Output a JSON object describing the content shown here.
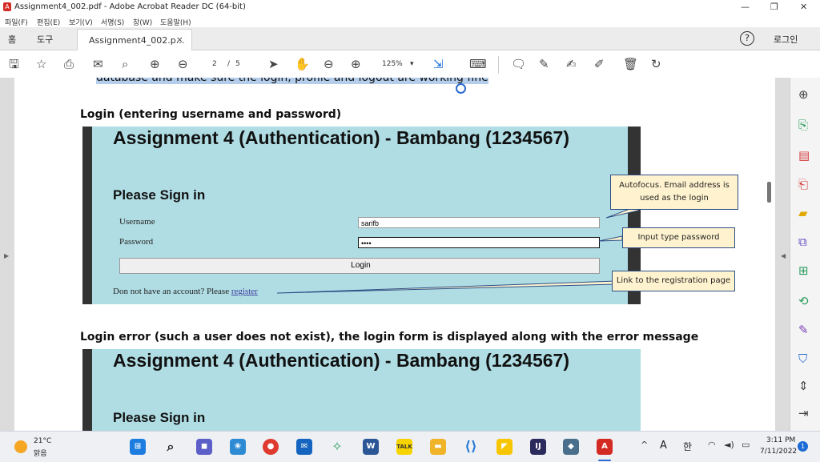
{
  "window": {
    "title": "Assignment4_002.pdf - Adobe Acrobat Reader DC (64-bit)",
    "minimize": "—",
    "restore": "❐",
    "close": "✕"
  },
  "menu": [
    "파일(F)",
    "편집(E)",
    "보기(V)",
    "서명(S)",
    "창(W)",
    "도움말(H)"
  ],
  "tabs": {
    "home": "홈",
    "tools": "도구",
    "document": "Assignment4_002.p...",
    "close": "×",
    "help": "?",
    "login": "로그인"
  },
  "toolbar": {
    "page_current": "2",
    "page_sep": "/",
    "page_total": "5",
    "zoom": "125%"
  },
  "document": {
    "cut_text": "database and make sure the login, profile and logout are working fine",
    "section1_heading": "Login (entering username and password)",
    "section2_heading": "Login error (such a user does not exist), the login form is displayed along with the error message",
    "app_title": "Assignment 4 (Authentication) - Bambang (1234567)",
    "sign_in_heading": "Please Sign in",
    "username_label": "Username",
    "username_value": "sarifb",
    "password_label": "Password",
    "password_value": "••••",
    "login_button": "Login",
    "register_prefix": "Don not have an account? Please ",
    "register_link": "register",
    "callout_autofocus": "Autofocus. Email address is used as the login",
    "callout_password": "Input type password",
    "callout_register": "Link to the registration page"
  },
  "taskbar": {
    "weather_temp": "21°C",
    "weather_desc": "맑음",
    "ime_a": "A",
    "ime_han": "한",
    "time": "3:11 PM",
    "date": "7/11/2022",
    "notification_count": "1"
  },
  "colors": {
    "acrobat_red": "#d42a24",
    "shot_bg": "#b0dde4",
    "callout_bg": "#fff3cf",
    "callout_border": "#2c4f86"
  }
}
